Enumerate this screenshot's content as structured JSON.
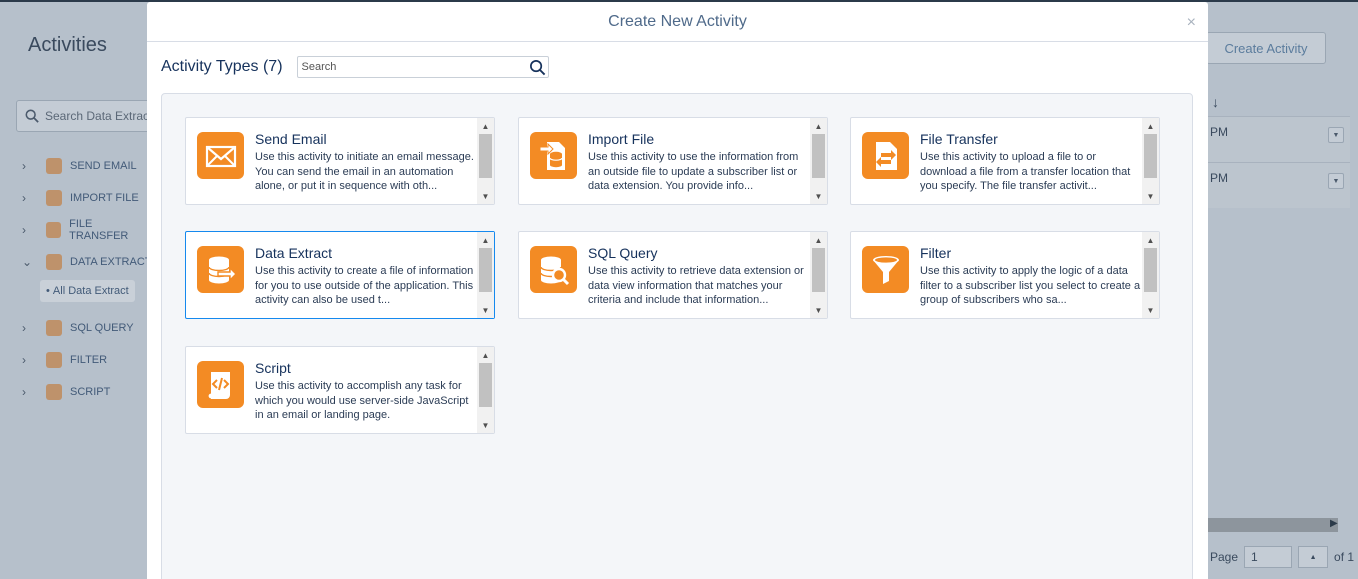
{
  "background": {
    "title": "Activities",
    "search_placeholder": "Search Data Extract",
    "create_button": "Create Activity",
    "sort_arrow": "↓",
    "nav": [
      {
        "label": "SEND EMAIL",
        "chevron": "›"
      },
      {
        "label": "IMPORT FILE",
        "chevron": "›"
      },
      {
        "label": "FILE TRANSFER",
        "chevron": "›"
      },
      {
        "label": "DATA EXTRACT",
        "chevron": "⌄"
      },
      {
        "label": "SQL QUERY",
        "chevron": "›"
      },
      {
        "label": "FILTER",
        "chevron": "›"
      },
      {
        "label": "SCRIPT",
        "chevron": "›"
      }
    ],
    "sub_item": "All Data Extract",
    "rows": [
      "PM",
      "PM"
    ],
    "pager": {
      "label": "Page",
      "value": "1",
      "of": "of 1"
    }
  },
  "modal": {
    "title": "Create New Activity",
    "close": "×",
    "types_label": "Activity Types (7)",
    "search_placeholder": "Search",
    "accent_color": "#f38b24",
    "selected_border": "#1589ee",
    "cards": [
      {
        "title": "Send Email",
        "icon": "envelope-icon",
        "desc": "Use this activity to initiate an email message. You can send the email in an automation alone, or put it in sequence with oth..."
      },
      {
        "title": "Import File",
        "icon": "import-file-icon",
        "desc": "Use this activity to use the information from an outside file to update a subscriber list or data extension. You provide info..."
      },
      {
        "title": "File Transfer",
        "icon": "file-transfer-icon",
        "desc": "Use this activity to upload a file to or download a file from a transfer location that you specify. The file transfer activit..."
      },
      {
        "title": "Data Extract",
        "icon": "data-extract-icon",
        "desc": "Use this activity to create a file of information for you to use outside of the application. This activity can also be used t..."
      },
      {
        "title": "SQL Query",
        "icon": "sql-query-icon",
        "desc": "Use this activity to retrieve data extension or data view information that matches your criteria and include that information..."
      },
      {
        "title": "Filter",
        "icon": "filter-icon",
        "desc": "Use this activity to apply the logic of a data filter to a subscriber list you select to create a group of subscribers who sa..."
      },
      {
        "title": "Script",
        "icon": "script-icon",
        "desc": "Use this activity to accomplish any task for which you would use server-side JavaScript in an email or landing page."
      }
    ]
  }
}
